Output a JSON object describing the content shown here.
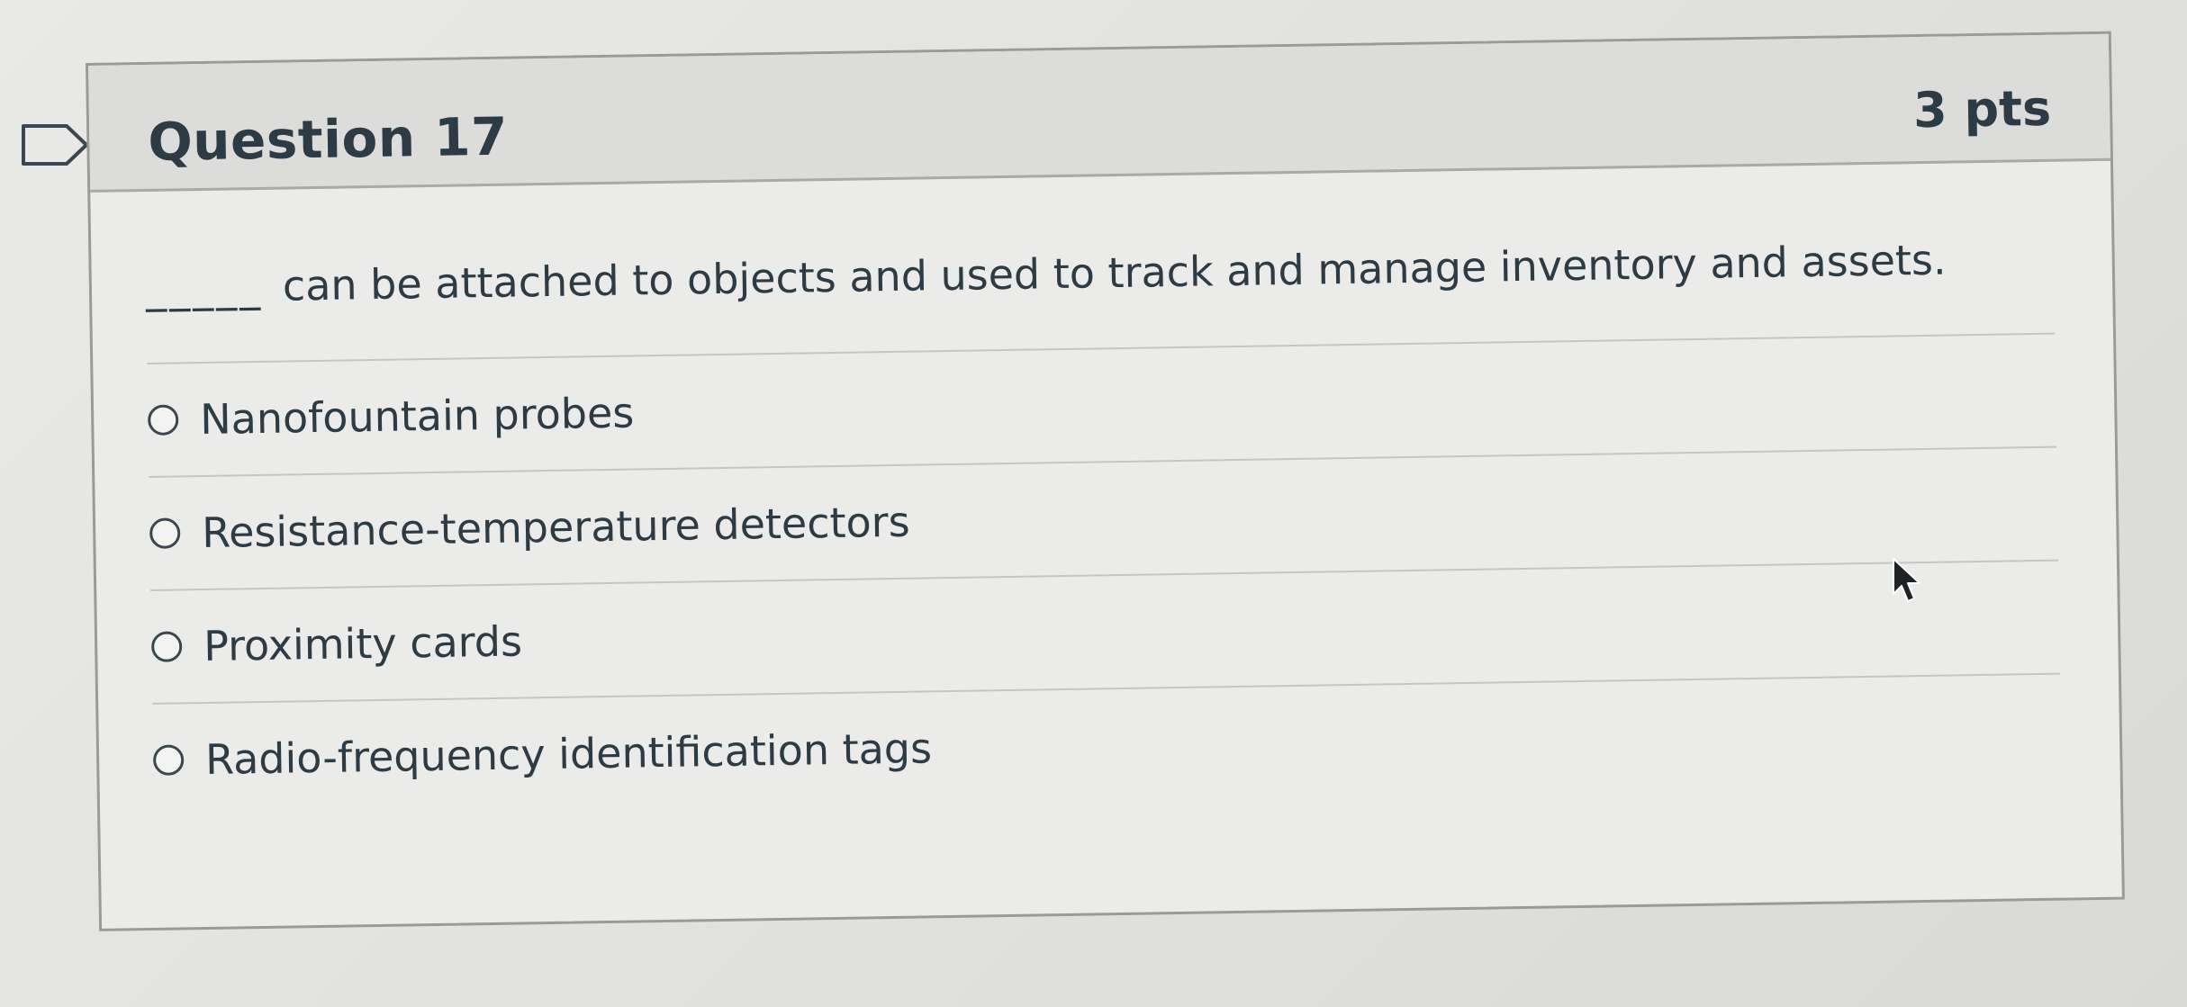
{
  "question": {
    "title": "Question 17",
    "points": "3 pts",
    "prompt_blank": "_____",
    "prompt_text": "can be attached to objects and used to track and manage inventory and assets.",
    "answers": [
      {
        "label": "Nanofountain probes"
      },
      {
        "label": "Resistance-temperature detectors"
      },
      {
        "label": "Proximity cards"
      },
      {
        "label": "Radio-frequency identification tags"
      }
    ]
  },
  "icons": {
    "bookmark": "bookmark-flag-icon",
    "radio": "radio-button-icon",
    "cursor": "mouse-pointer-icon"
  },
  "colors": {
    "text": "#2d3b45",
    "header_bg": "#dcdcda",
    "card_bg": "#ebebe9",
    "border": "#9a9a98"
  }
}
